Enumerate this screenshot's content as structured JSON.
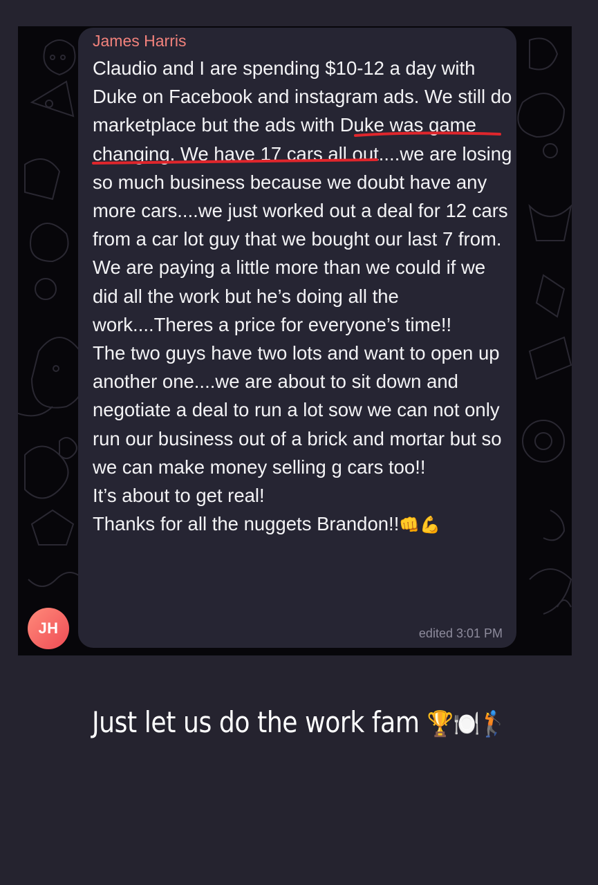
{
  "chat": {
    "sender_name": "James Harris",
    "avatar_initials": "JH",
    "avatar_color": "#f2665e",
    "sender_color": "#f2827c",
    "bubble_color": "#262533",
    "message": {
      "paragraph1": "Claudio and I are spending $10-12 a day with Duke on Facebook and instagram ads. We still do marketplace but the ads with Duke was game changing. We have 17 cars all out....we are losing so much business because we doubt have any more cars....we just worked out a deal for 12 cars from a car lot guy that we bought our last 7 from.  We are paying a little more than we could if we did all the work but he’s doing all the work....Theres a price for everyone’s time!!",
      "paragraph2": "The two guys have two lots and want to open up another one....we are about to sit down and negotiate a deal to run a lot sow we can not only run our business out of a brick and mortar but so we can make money selling g cars too!!",
      "paragraph3": "It’s about to get real!",
      "paragraph4": "Thanks for all the nuggets Brandon!!",
      "paragraph4_emoji": "👊💪"
    },
    "timestamp": "edited 3:01 PM",
    "highlight_color": "#e0262c"
  },
  "caption": {
    "text": "Just let us do the work fam",
    "emoji": "🏆🍽️🏌️"
  }
}
